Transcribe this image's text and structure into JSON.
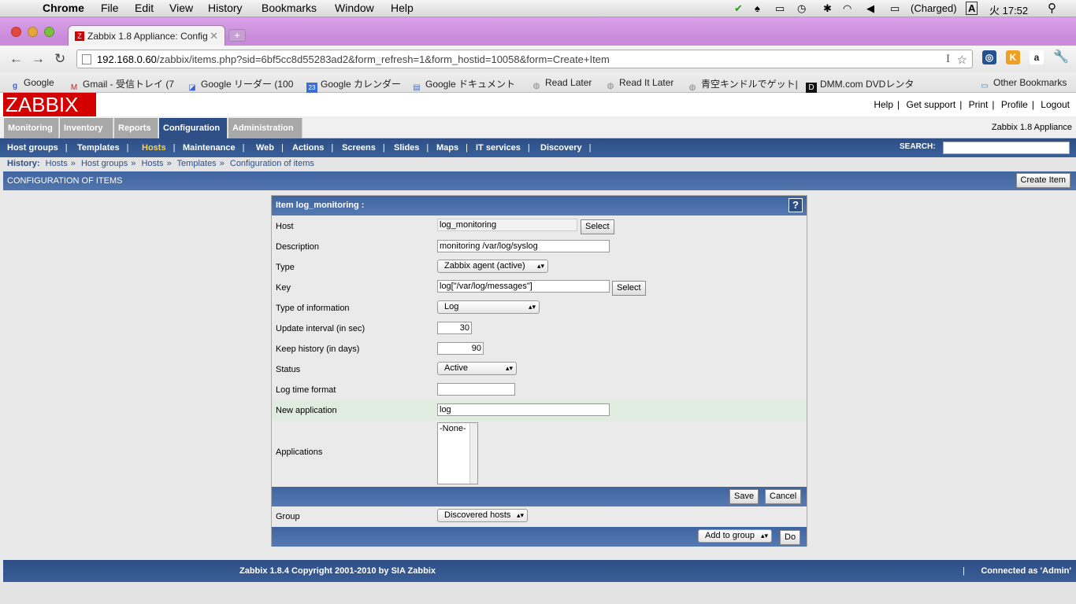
{
  "os_menubar": {
    "app": "Chrome",
    "items": [
      "File",
      "Edit",
      "View",
      "History",
      "Bookmarks",
      "Window",
      "Help"
    ],
    "battery": "(Charged)",
    "input_method": "A",
    "clock": "火 17:52"
  },
  "browser": {
    "tab_title": "Zabbix 1.8 Appliance: Config",
    "new_tab": "+",
    "url_host": "192.168.0.60",
    "url_path": "/zabbix/items.php?sid=6bf5cc8d55283ad2&form_refresh=1&form_hostid=10058&form=Create+Item",
    "bookmarks": [
      "Google",
      "Gmail - 受信トレイ (7",
      "Google リーダー (100",
      "Google カレンダー",
      "Google ドキュメント",
      "Read Later",
      "Read It Later",
      "青空キンドルでゲット|",
      "DMM.com DVDレンタ"
    ],
    "calendar_badge": "23",
    "other_bookmarks": "Other Bookmarks",
    "ext_k": "K",
    "ext_a": "a"
  },
  "zabbix": {
    "logo": "ZABBIX",
    "top_links": [
      "Help",
      "Get support",
      "Print",
      "Profile",
      "Logout"
    ],
    "appliance_name": "Zabbix 1.8 Appliance",
    "main_tabs": [
      "Monitoring",
      "Inventory",
      "Reports",
      "Configuration",
      "Administration"
    ],
    "sub_menu": [
      "Host groups",
      "Templates",
      "Hosts",
      "Maintenance",
      "Web",
      "Actions",
      "Screens",
      "Slides",
      "Maps",
      "IT services",
      "Discovery"
    ],
    "search_label": "SEARCH:",
    "history_label": "History:",
    "history": [
      "Hosts",
      "Host groups",
      "Hosts",
      "Templates",
      "Configuration of items"
    ],
    "page_title": "CONFIGURATION OF ITEMS",
    "create_item": "Create Item"
  },
  "form": {
    "title": "Item log_monitoring :",
    "help": "?",
    "host_label": "Host",
    "host_value": "log_monitoring",
    "select": "Select",
    "description_label": "Description",
    "description_value": "monitoring /var/log/syslog",
    "type_label": "Type",
    "type_value": "Zabbix agent (active)",
    "key_label": "Key",
    "key_value": "log[\"/var/log/messages\"]",
    "type_info_label": "Type of information",
    "type_info_value": "Log",
    "update_label": "Update interval (in sec)",
    "update_value": "30",
    "history_label": "Keep history (in days)",
    "history_value": "90",
    "status_label": "Status",
    "status_value": "Active",
    "logtime_label": "Log time format",
    "logtime_value": "",
    "newapp_label": "New application",
    "newapp_value": "log",
    "apps_label": "Applications",
    "apps_option": "-None-",
    "save": "Save",
    "cancel": "Cancel",
    "group_label": "Group",
    "group_value": "Discovered hosts",
    "add_to_group": "Add to group",
    "do": "Do"
  },
  "footer": {
    "copyright": "Zabbix 1.8.4 Copyright 2001-2010 by SIA Zabbix",
    "separator": "|",
    "connected": "Connected as 'Admin'"
  }
}
